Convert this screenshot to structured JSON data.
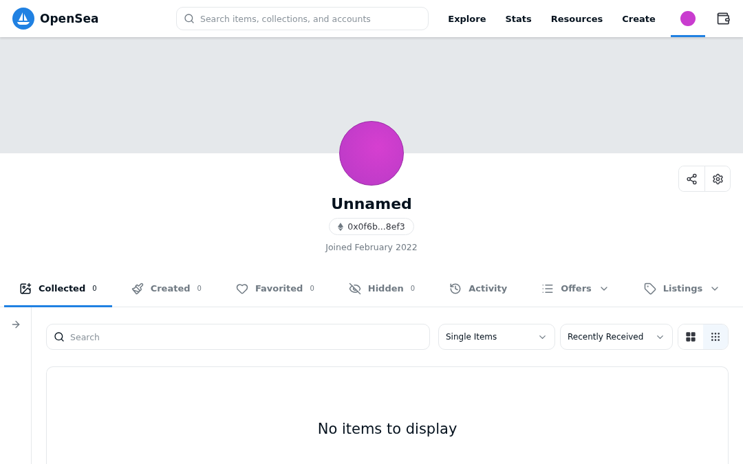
{
  "brand": {
    "name": "OpenSea"
  },
  "search": {
    "placeholder": "Search items, collections, and accounts"
  },
  "nav": [
    {
      "label": "Explore"
    },
    {
      "label": "Stats"
    },
    {
      "label": "Resources"
    },
    {
      "label": "Create"
    }
  ],
  "account": {
    "selected": true
  },
  "profile": {
    "name": "Unnamed",
    "address": "0x0f6b...8ef3",
    "joined": "Joined February 2022"
  },
  "tabs": [
    {
      "label": "Collected",
      "count": "0",
      "selected": true,
      "dropdown": false
    },
    {
      "label": "Created",
      "count": "0",
      "selected": false,
      "dropdown": false
    },
    {
      "label": "Favorited",
      "count": "0",
      "selected": false,
      "dropdown": false
    },
    {
      "label": "Hidden",
      "count": "0",
      "selected": false,
      "dropdown": false
    },
    {
      "label": "Activity",
      "selected": false,
      "dropdown": false
    },
    {
      "label": "Offers",
      "selected": false,
      "dropdown": true
    },
    {
      "label": "Listings",
      "selected": false,
      "dropdown": true
    }
  ],
  "filters": {
    "search_placeholder": "Search",
    "type": "Single Items",
    "sort": "Recently Received"
  },
  "view_modes": [
    {
      "selected": false
    },
    {
      "selected": true
    }
  ],
  "empty_message": "No items to display"
}
